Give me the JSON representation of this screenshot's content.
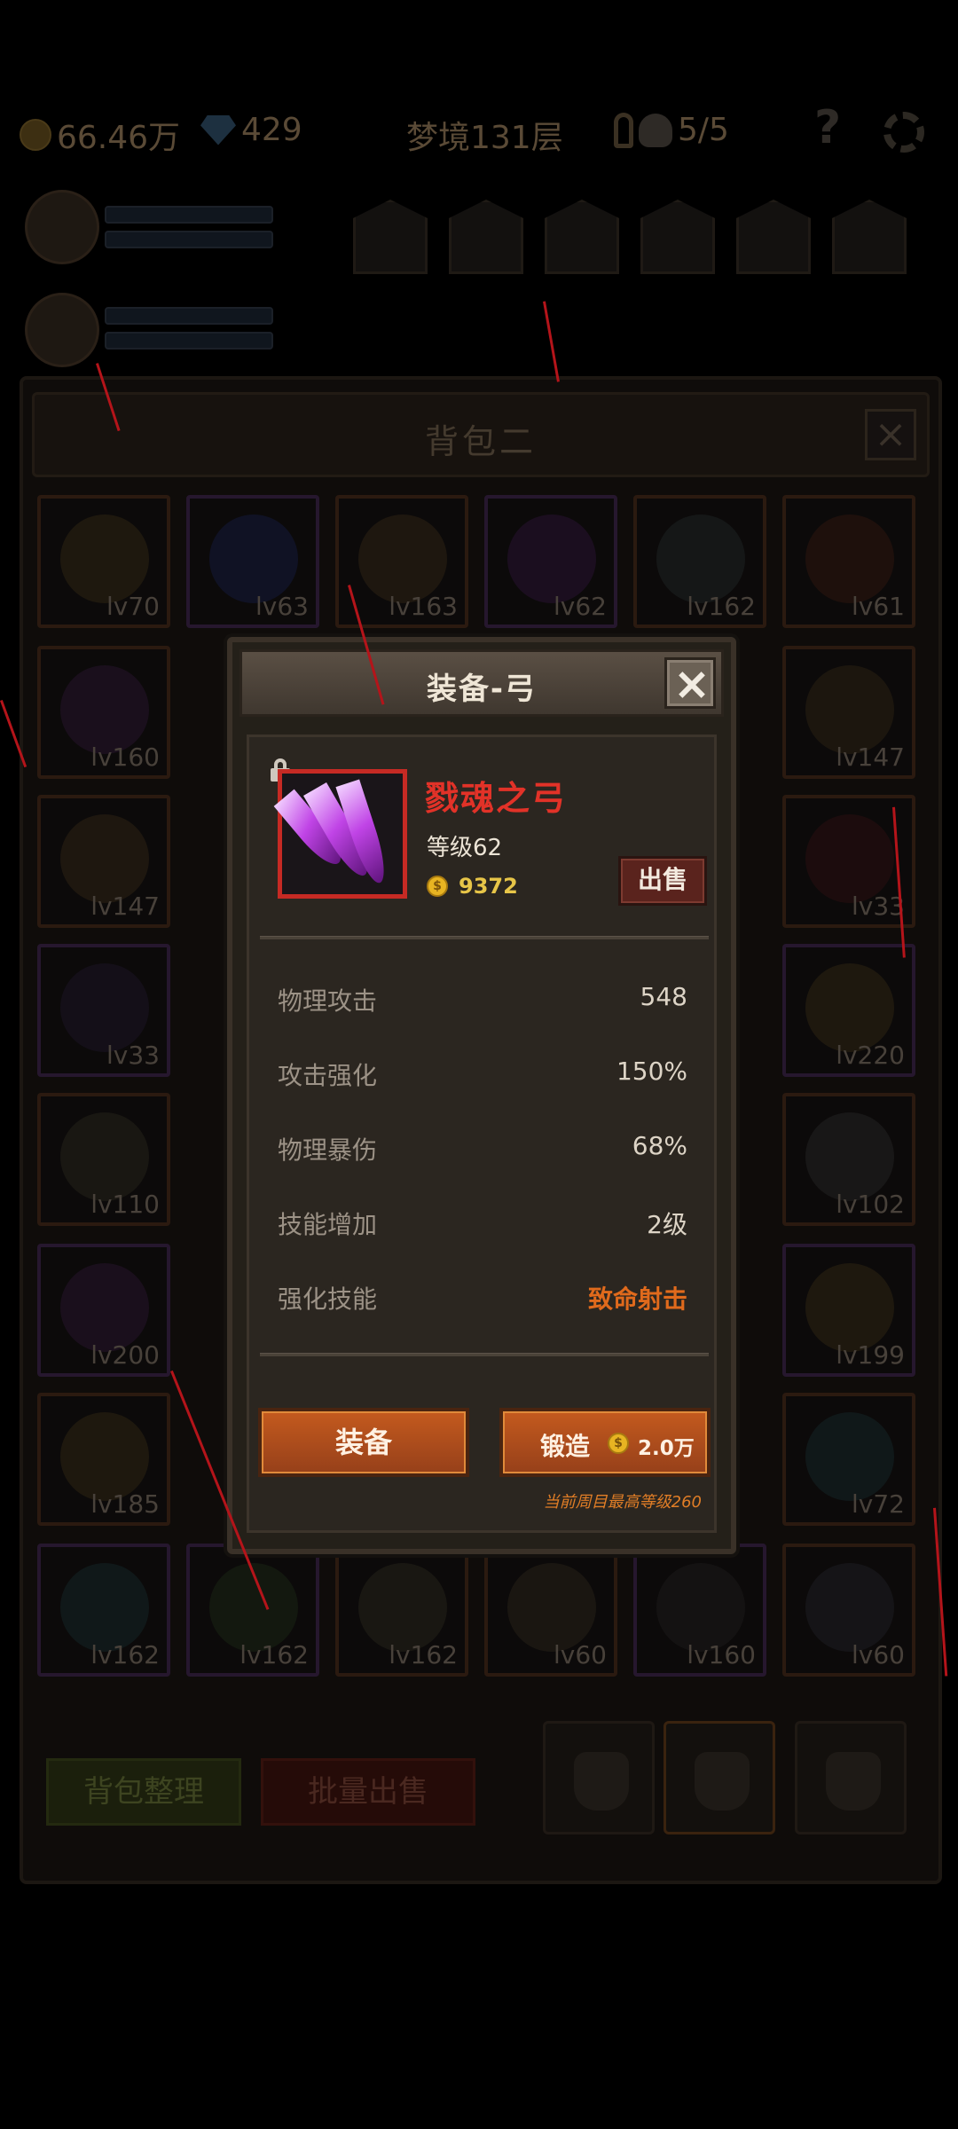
{
  "topbar": {
    "gold": "66.46万",
    "gems": "429",
    "dungeon": "梦境131层",
    "skull_count": "5/5",
    "help_icon": "question-mark-icon",
    "settings_icon": "gear-icon"
  },
  "bag": {
    "title": "背包二",
    "slots": [
      {
        "level": "lv70"
      },
      {
        "level": "lv63"
      },
      {
        "level": "lv163"
      },
      {
        "level": "lv62"
      },
      {
        "level": "lv162"
      },
      {
        "level": "lv61"
      },
      {
        "level": "lv160"
      },
      {
        "level": "lv147"
      },
      {
        "level": "lv147"
      },
      {
        "level": "lv33"
      },
      {
        "level": "lv33"
      },
      {
        "level": "lv220"
      },
      {
        "level": "lv110"
      },
      {
        "level": "lv102"
      },
      {
        "level": "lv200"
      },
      {
        "level": "lv199"
      },
      {
        "level": "lv185"
      },
      {
        "level": "lv72"
      },
      {
        "level": "lv162"
      },
      {
        "level": "lv162"
      },
      {
        "level": "lv162"
      },
      {
        "level": "lv60"
      },
      {
        "level": "lv160"
      },
      {
        "level": "lv60"
      }
    ],
    "sort_label": "背包整理",
    "bulk_sell_label": "批量出售"
  },
  "dialog": {
    "title": "装备-弓",
    "item": {
      "name": "戮魂之弓",
      "level": "等级62",
      "price": "9372",
      "sell_label": "出售",
      "frame_color": "#c62a24"
    },
    "stats": [
      {
        "label": "物理攻击",
        "value": "548"
      },
      {
        "label": "攻击强化",
        "value": "150%"
      },
      {
        "label": "物理暴伤",
        "value": "68%"
      },
      {
        "label": "技能增加",
        "value": "2级"
      },
      {
        "label": "强化技能",
        "value": "致命射击"
      }
    ],
    "equip_label": "装备",
    "forge_label": "锻造",
    "forge_cost": "2.0万",
    "max_level_note": "当前周目最高等级260"
  }
}
